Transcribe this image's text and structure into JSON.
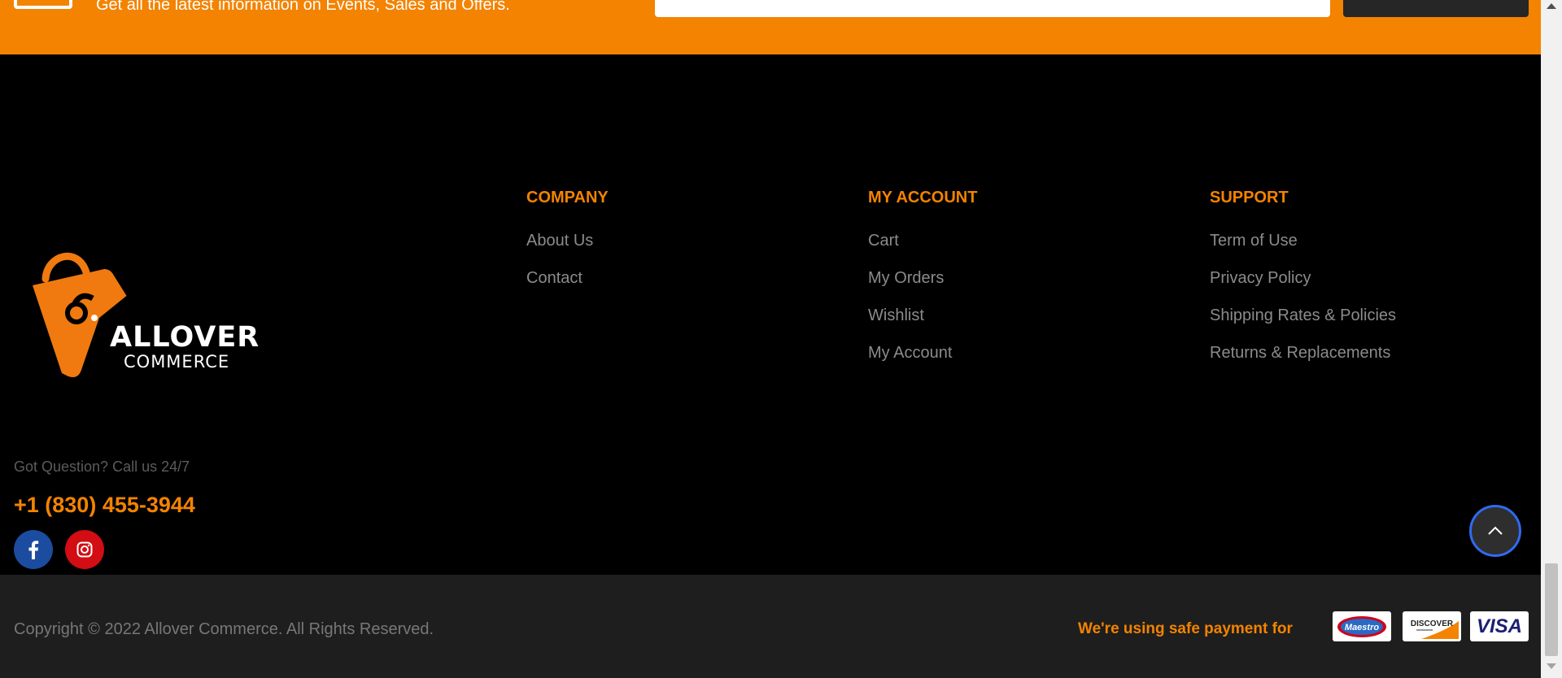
{
  "newsletter": {
    "text": "Get all the latest information on Events, Sales and Offers.",
    "email_placeholder": "",
    "subscribe_label": ""
  },
  "brand": {
    "name_line1": "ALLOVER",
    "name_line2": "COMMERCE",
    "accent_color": "#f38300"
  },
  "contact": {
    "question": "Got Question? Call us 24/7",
    "phone": "+1 (830) 455-3944"
  },
  "social": [
    {
      "name": "facebook",
      "icon": "facebook-icon",
      "color": "#1b4ca0"
    },
    {
      "name": "instagram",
      "icon": "instagram-icon",
      "color": "#d20d14"
    }
  ],
  "columns": {
    "company": {
      "heading": "COMPANY",
      "links": [
        "About Us",
        "Contact"
      ]
    },
    "account": {
      "heading": "MY ACCOUNT",
      "links": [
        "Cart",
        "My Orders",
        "Wishlist",
        "My Account"
      ]
    },
    "support": {
      "heading": "SUPPORT",
      "links": [
        "Term of Use",
        "Privacy Policy",
        "Shipping Rates & Policies",
        "Returns & Replacements"
      ]
    }
  },
  "bottom": {
    "copyright": "Copyright © 2022 Allover Commerce. All Rights Reserved.",
    "payment_label": "We're using safe payment for",
    "cards": {
      "maestro": "Maestro",
      "discover": "DISCOVER",
      "visa": "VISA"
    }
  }
}
